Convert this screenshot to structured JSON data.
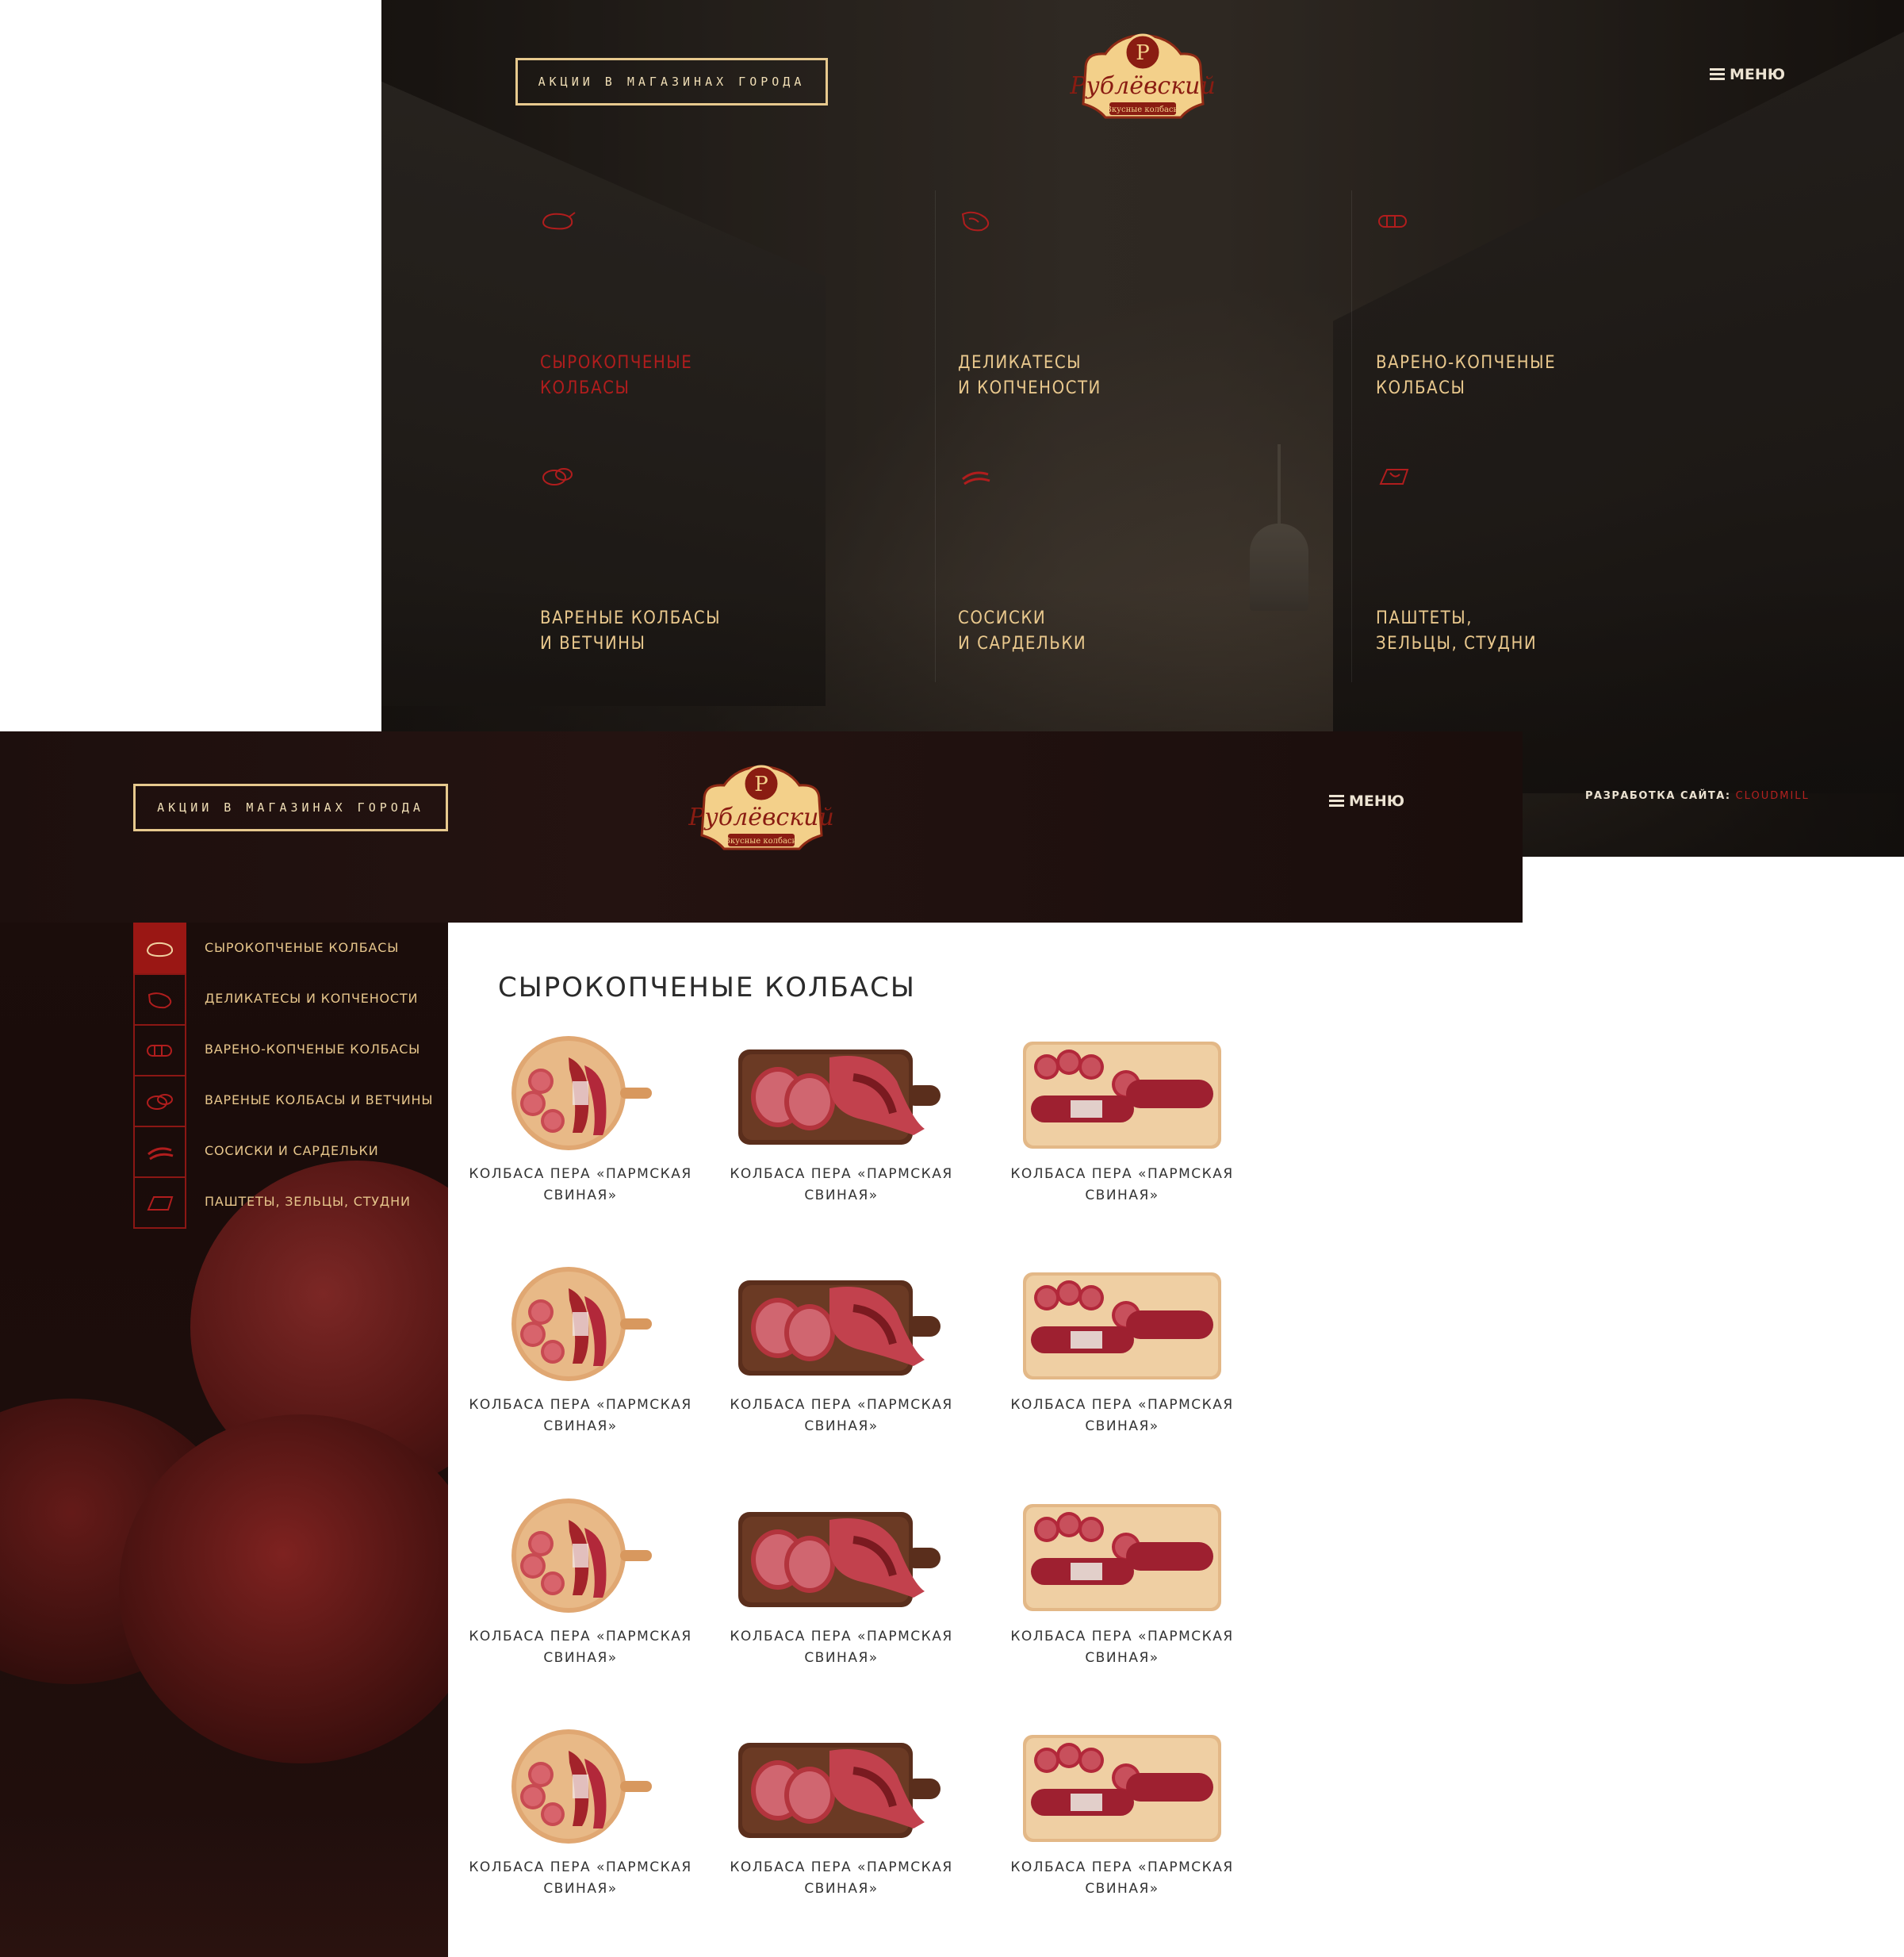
{
  "top": {
    "promo_label": "АКЦИИ В МАГАЗИНАХ ГОРОДА",
    "menu_label": "МЕНЮ",
    "logo_text": "Рублёвский",
    "logo_tagline": "Вкусные колбасы",
    "categories": [
      {
        "label": "СЫРОКОПЧЕНЫЕ\nКОЛБАСЫ",
        "icon": "salami-icon",
        "active": true
      },
      {
        "label": "ДЕЛИКАТЕСЫ\nИ КОПЧЕНОСТИ",
        "icon": "ham-icon",
        "active": false
      },
      {
        "label": "ВАРЕНО-КОПЧЕНЫЕ\nКОЛБАСЫ",
        "icon": "sausage-icon",
        "active": false
      },
      {
        "label": "ВАРЕНЫЕ КОЛБАСЫ\nИ ВЕТЧИНЫ",
        "icon": "sliced-sausage-icon",
        "active": false
      },
      {
        "label": "СОСИСКИ\nИ САРДЕЛЬКИ",
        "icon": "hotdog-icon",
        "active": false
      },
      {
        "label": "ПАШТЕТЫ,\nЗЕЛЬЦЫ, СТУДНИ",
        "icon": "pate-icon",
        "active": false
      }
    ],
    "dev_label": "РАЗРАБОТКА САЙТА:",
    "dev_name": "CLOUDMILL"
  },
  "catalog": {
    "promo_label": "АКЦИИ В МАГАЗИНАХ ГОРОДА",
    "menu_label": "МЕНЮ",
    "logo_text": "Рублёвский",
    "logo_tagline": "Вкусные колбасы",
    "title": "СЫРОКОПЧЕНЫЕ КОЛБАСЫ",
    "sidebar": [
      {
        "label": "СЫРОКОПЧЕНЫЕ КОЛБАСЫ",
        "icon": "salami-icon",
        "active": true
      },
      {
        "label": "ДЕЛИКАТЕСЫ И КОПЧЕНОСТИ",
        "icon": "ham-icon",
        "active": false
      },
      {
        "label": "ВАРЕНО-КОПЧЕНЫЕ КОЛБАСЫ",
        "icon": "sausage-icon",
        "active": false
      },
      {
        "label": "ВАРЕНЫЕ КОЛБАСЫ И ВЕТЧИНЫ",
        "icon": "sliced-sausage-icon",
        "active": false
      },
      {
        "label": "СОСИСКИ И САРДЕЛЬКИ",
        "icon": "hotdog-icon",
        "active": false
      },
      {
        "label": "ПАШТЕТЫ, ЗЕЛЬЦЫ, СТУДНИ",
        "icon": "pate-icon",
        "active": false
      }
    ],
    "products": [
      {
        "name": "КОЛБАСА ПЕРА «ПАРМСКАЯ\nСВИНАЯ»",
        "board": "round"
      },
      {
        "name": "КОЛБАСА ПЕРА «ПАРМСКАЯ\nСВИНАЯ»",
        "board": "dark"
      },
      {
        "name": "КОЛБАСА ПЕРА «ПАРМСКАЯ\nСВИНАЯ»",
        "board": "light"
      },
      {
        "name": "КОЛБАСА ПЕРА «ПАРМСКАЯ\nСВИНАЯ»",
        "board": "round"
      },
      {
        "name": "КОЛБАСА ПЕРА «ПАРМСКАЯ\nСВИНАЯ»",
        "board": "dark"
      },
      {
        "name": "КОЛБАСА ПЕРА «ПАРМСКАЯ\nСВИНАЯ»",
        "board": "light"
      },
      {
        "name": "КОЛБАСА ПЕРА «ПАРМСКАЯ\nСВИНАЯ»",
        "board": "round"
      },
      {
        "name": "КОЛБАСА ПЕРА «ПАРМСКАЯ\nСВИНАЯ»",
        "board": "dark"
      },
      {
        "name": "КОЛБАСА ПЕРА «ПАРМСКАЯ\nСВИНАЯ»",
        "board": "light"
      },
      {
        "name": "КОЛБАСА ПЕРА «ПАРМСКАЯ\nСВИНАЯ»",
        "board": "round"
      },
      {
        "name": "КОЛБАСА ПЕРА «ПАРМСКАЯ\nСВИНАЯ»",
        "board": "dark"
      },
      {
        "name": "КОЛБАСА ПЕРА «ПАРМСКАЯ\nСВИНАЯ»",
        "board": "light"
      }
    ]
  },
  "colors": {
    "accent_red": "#b01d1d",
    "gold": "#e9c88d",
    "dark_bg": "#1d0f0d"
  }
}
